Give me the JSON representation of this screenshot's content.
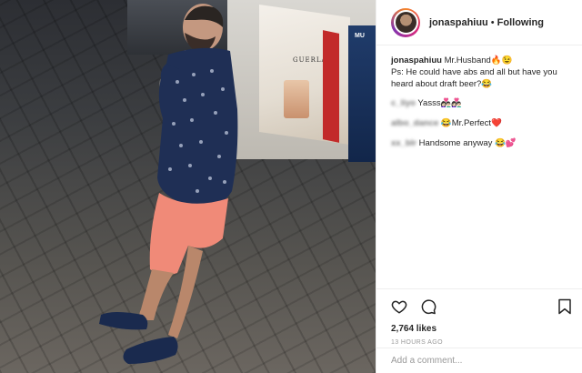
{
  "post": {
    "username": "jonaspahiuu",
    "separator": "•",
    "follow_status": "Following",
    "photo_alt": "Man in navy printed shirt and coral shorts standing on a brick pavement at night",
    "shop_sign": "GUERLAIN",
    "shop_label": "MU"
  },
  "caption": {
    "username": "jonaspahiuu",
    "text": "Mr.Husband🔥😉",
    "text2": "Ps: He could have abs and all but have you heard about draft beer?😂"
  },
  "comments": [
    {
      "username": "c_liyo",
      "text": "Yasss👩🏻‍❤️‍👨🏻👩🏻‍❤️‍👨🏻"
    },
    {
      "username": "albo_dance",
      "text": "😂Mr.Perfect❤️"
    },
    {
      "username": "xx_blr",
      "text": "Handsome anyway 😂💕"
    }
  ],
  "actions": {
    "like_icon": "heart-outline-icon",
    "comment_icon": "speech-bubble-icon",
    "save_icon": "bookmark-icon"
  },
  "likes": "2,764 likes",
  "timestamp": "13 HOURS AGO",
  "add_comment_placeholder": "Add a comment..."
}
